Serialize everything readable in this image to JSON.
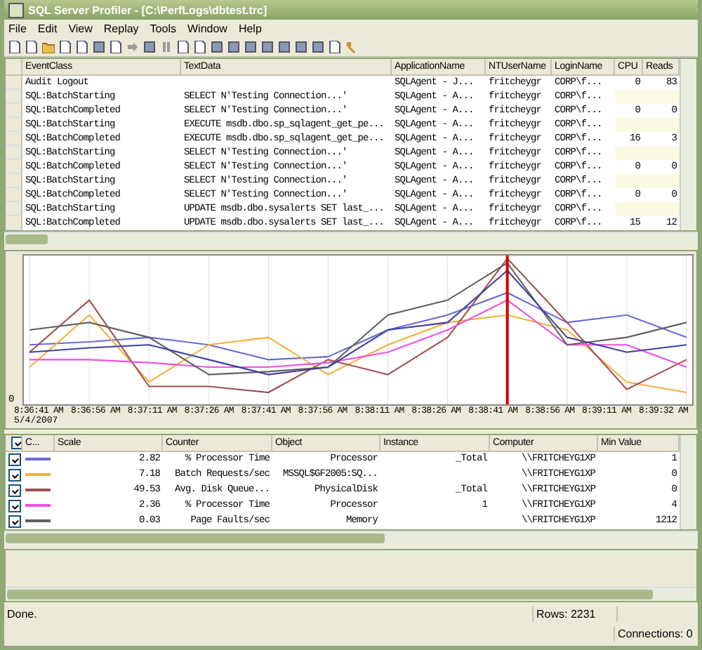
{
  "window": {
    "title": "SQL Server Profiler - [C:\\PerfLogs\\dbtest.trc]"
  },
  "menu": [
    "File",
    "Edit",
    "View",
    "Replay",
    "Tools",
    "Window",
    "Help"
  ],
  "trace_grid": {
    "columns": [
      "EventClass",
      "TextData",
      "ApplicationName",
      "NTUserName",
      "LoginName",
      "CPU",
      "Reads"
    ],
    "rows": [
      [
        "Audit Logout",
        "",
        "SQLAgent - J...",
        "fritcheygr",
        "CORP\\f...",
        "0",
        "83"
      ],
      [
        "SQL:BatchStarting",
        "SELECT N'Testing Connection...'",
        "SQLAgent - A...",
        "fritcheygr",
        "CORP\\f...",
        "",
        ""
      ],
      [
        "SQL:BatchCompleted",
        "SELECT N'Testing Connection...'",
        "SQLAgent - A...",
        "fritcheygr",
        "CORP\\f...",
        "0",
        "0"
      ],
      [
        "SQL:BatchStarting",
        "EXECUTE msdb.dbo.sp_sqlagent_get_pe...",
        "SQLAgent - A...",
        "fritcheygr",
        "CORP\\f...",
        "",
        ""
      ],
      [
        "SQL:BatchCompleted",
        "EXECUTE msdb.dbo.sp_sqlagent_get_pe...",
        "SQLAgent - A...",
        "fritcheygr",
        "CORP\\f...",
        "16",
        "3"
      ],
      [
        "SQL:BatchStarting",
        "SELECT N'Testing Connection...'",
        "SQLAgent - A...",
        "fritcheygr",
        "CORP\\f...",
        "",
        ""
      ],
      [
        "SQL:BatchCompleted",
        "SELECT N'Testing Connection...'",
        "SQLAgent - A...",
        "fritcheygr",
        "CORP\\f...",
        "0",
        "0"
      ],
      [
        "SQL:BatchStarting",
        "SELECT N'Testing Connection...'",
        "SQLAgent - A...",
        "fritcheygr",
        "CORP\\f...",
        "",
        ""
      ],
      [
        "SQL:BatchCompleted",
        "SELECT N'Testing Connection...'",
        "SQLAgent - A...",
        "fritcheygr",
        "CORP\\f...",
        "0",
        "0"
      ],
      [
        "SQL:BatchStarting",
        "UPDATE msdb.dbo.sysalerts SET last_...",
        "SQLAgent - A...",
        "fritcheygr",
        "CORP\\f...",
        "",
        ""
      ],
      [
        "SQL:BatchCompleted",
        "UPDATE msdb.dbo.sysalerts SET last_...",
        "SQLAgent - A...",
        "fritcheygr",
        "CORP\\f...",
        "15",
        "12"
      ]
    ]
  },
  "perf_chart": {
    "y_label": "0",
    "x_labels": [
      "8:36:41 AM",
      "8:36:56 AM",
      "8:37:11 AM",
      "8:37:26 AM",
      "8:37:41 AM",
      "8:37:56 AM",
      "8:38:11 AM",
      "8:38:26 AM",
      "8:38:41 AM",
      "8:38:56 AM",
      "8:39:11 AM",
      "8:39:32 AM"
    ],
    "date": "5/4/2007"
  },
  "counter_grid": {
    "all_checked": true,
    "columns": [
      "C...",
      "Scale",
      "Counter",
      "Object",
      "Instance",
      "Computer",
      "Min Value"
    ],
    "rows": [
      {
        "checked": true,
        "color": "#6a6ad8",
        "scale": "2.82",
        "counter": "% Processor Time",
        "object": "Processor",
        "instance": "_Total",
        "computer": "\\\\FRITCHEYG1XP",
        "min": "1"
      },
      {
        "checked": true,
        "color": "#f0b040",
        "scale": "7.18",
        "counter": "Batch Requests/sec",
        "object": "MSSQL$GF2005:SQ...",
        "instance": "",
        "computer": "\\\\FRITCHEYG1XP",
        "min": "0"
      },
      {
        "checked": true,
        "color": "#a05050",
        "scale": "49.53",
        "counter": "Avg. Disk Queue...",
        "object": "PhysicalDisk",
        "instance": "_Total",
        "computer": "\\\\FRITCHEYG1XP",
        "min": "0"
      },
      {
        "checked": true,
        "color": "#f050e0",
        "scale": "2.36",
        "counter": "% Processor Time",
        "object": "Processor",
        "instance": "1",
        "computer": "\\\\FRITCHEYG1XP",
        "min": "4"
      },
      {
        "checked": true,
        "color": "#606060",
        "scale": "0.03",
        "counter": "Page Faults/sec",
        "object": "Memory",
        "instance": "",
        "computer": "\\\\FRITCHEYG1XP",
        "min": "1212"
      }
    ]
  },
  "status_bar": {
    "message": "Done.",
    "rows": "Rows: 2231",
    "connections": "Connections: 0"
  }
}
